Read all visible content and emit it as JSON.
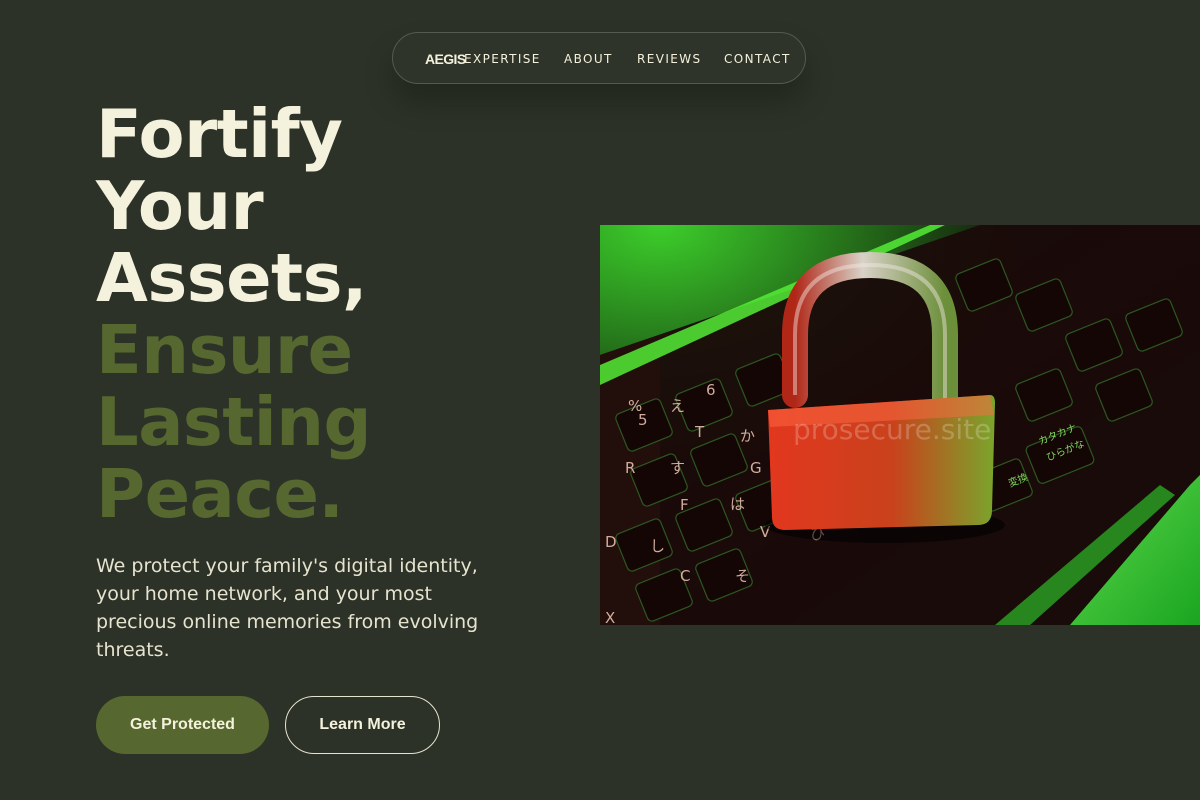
{
  "nav": {
    "logo": "AEGIS",
    "links": [
      "EXPERTISE",
      "ABOUT",
      "REVIEWS",
      "CONTACT"
    ]
  },
  "hero": {
    "title_lines": [
      "Fortify",
      "Your",
      "Assets,"
    ],
    "accent_lines": [
      "Ensure",
      "Lasting",
      "Peace."
    ],
    "description": "We protect your family's digital identity, your home network, and your most precious online memories from evolving threats.",
    "primary_cta": "Get Protected",
    "secondary_cta": "Learn More"
  },
  "image": {
    "watermark": "prosecure.site",
    "key_labels": [
      "%",
      "5",
      "え",
      "6",
      "T",
      "か",
      "R",
      "す",
      "G",
      "F",
      "は",
      "D",
      "し",
      "C",
      "そ",
      "V",
      "ひ",
      "X",
      "カタカナ",
      "ひらがな",
      "変換"
    ]
  },
  "colors": {
    "background": "#2c3227",
    "text_light": "#f4f1dc",
    "accent_green": "#56682f"
  }
}
